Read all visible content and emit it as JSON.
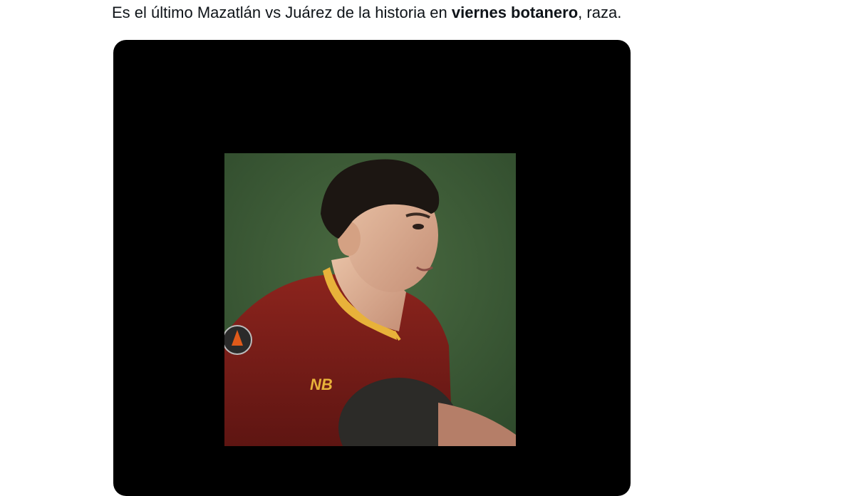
{
  "tweet": {
    "text_part1": "Es el último Mazatlán vs Juárez de la historia en ",
    "text_bold": "viernes botanero",
    "text_part2": ", raza."
  },
  "media": {
    "type": "video",
    "description_icon": "video-player",
    "jersey_brand_text": "NB"
  },
  "colors": {
    "text": "#0f1419",
    "card_background": "#000000",
    "pitch_green": "#3d5b36",
    "jersey_red": "#7a1c18",
    "jersey_trim": "#e8b23a"
  }
}
